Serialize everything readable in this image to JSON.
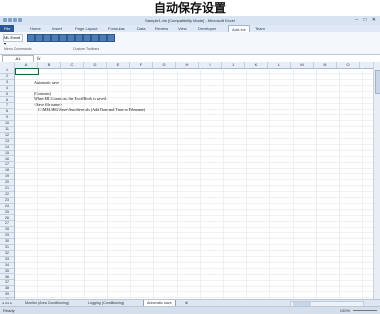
{
  "header_caption": "自动保存设置",
  "window": {
    "title": "Sample1.xls [Compatibility Mode] - Microsoft Excel",
    "controls": "–  □  ✕"
  },
  "ribbon_tabs": [
    {
      "label": "File"
    },
    {
      "label": "Home"
    },
    {
      "label": "Insert"
    },
    {
      "label": "Page Layout"
    },
    {
      "label": "Formulas"
    },
    {
      "label": "Data"
    },
    {
      "label": "Review"
    },
    {
      "label": "View"
    },
    {
      "label": "Developer"
    },
    {
      "label": "Add-Ins"
    },
    {
      "label": "Team"
    }
  ],
  "ribbon": {
    "menu_button": "ML Excel ▾",
    "group_menu": "Menu Commands",
    "group_toolbar": "Custom Toolbars"
  },
  "formula_bar": {
    "name_box": "A1",
    "fx": "fx"
  },
  "columns": [
    "A",
    "B",
    "C",
    "D",
    "E",
    "F",
    "G",
    "H",
    "I",
    "J",
    "K",
    "L",
    "M",
    "N",
    "O"
  ],
  "rows": [
    "1",
    "2",
    "3",
    "4",
    "5",
    "6",
    "7",
    "8",
    "9",
    "10",
    "11",
    "12",
    "13",
    "14",
    "15",
    "16",
    "17",
    "18",
    "19",
    "20",
    "21",
    "22",
    "23",
    "24",
    "25",
    "26",
    "27",
    "28",
    "29",
    "30",
    "31",
    "32",
    "33",
    "34",
    "35",
    "36",
    "37",
    "38",
    "39",
    "40",
    "41"
  ],
  "cells": [
    {
      "row": 2,
      "text": "Automatic save"
    },
    {
      "row": 4,
      "text": "[Contents]"
    },
    {
      "row": 5,
      "text": "When ML3 turns on, the ExcelBook is saved."
    },
    {
      "row": 6,
      "text": "<Save file name>"
    },
    {
      "row": 7,
      "text": "C:\\MELHIG\\Save\\AutoSave.xls  (Add Date and Time to Filename)"
    }
  ],
  "sheet_tabs": [
    {
      "label": "Monitor (Area Conditioning)"
    },
    {
      "label": "Logging (Conditioning)"
    },
    {
      "label": "Automatic save"
    }
  ],
  "status": {
    "text": "Ready",
    "zoom": "100%"
  }
}
